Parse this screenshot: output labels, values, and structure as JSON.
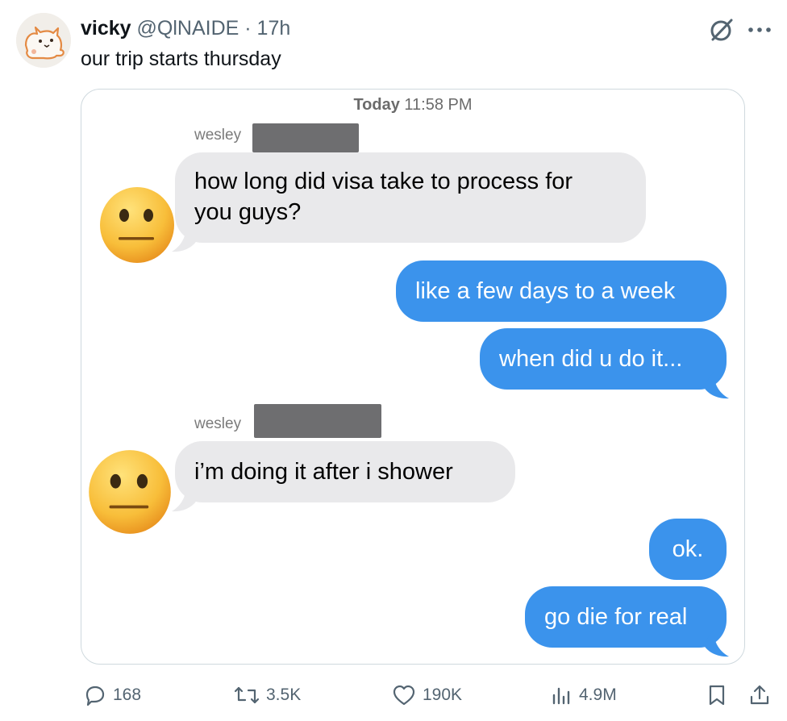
{
  "tweet": {
    "display_name": "vicky",
    "handle": "@QlNAIDE",
    "separator": "·",
    "time_ago": "17h",
    "text": "our trip starts thursday"
  },
  "conversation": {
    "timestamp_day": "Today",
    "timestamp_time": "11:58 PM",
    "sender_name": "wesley",
    "messages": [
      {
        "from": "received",
        "text_line1": "how long did visa take to process for",
        "text_line2": "you guys?"
      },
      {
        "from": "sent",
        "text": "like a few days to a week"
      },
      {
        "from": "sent",
        "text": "when did u do it..."
      },
      {
        "from": "received",
        "text": "i’m doing it after i shower"
      },
      {
        "from": "sent",
        "text": "ok."
      },
      {
        "from": "sent",
        "text": "go die for real"
      }
    ]
  },
  "actions": {
    "replies": "168",
    "reposts": "3.5K",
    "likes": "190K",
    "views": "4.9M"
  },
  "icons": [
    "grok-icon",
    "more-icon",
    "reply-icon",
    "repost-icon",
    "like-icon",
    "views-icon",
    "bookmark-icon",
    "share-icon"
  ],
  "colors": {
    "sent_bubble": "#3b93ec",
    "received_bubble": "#e9e9eb",
    "secondary_text": "#536471"
  }
}
